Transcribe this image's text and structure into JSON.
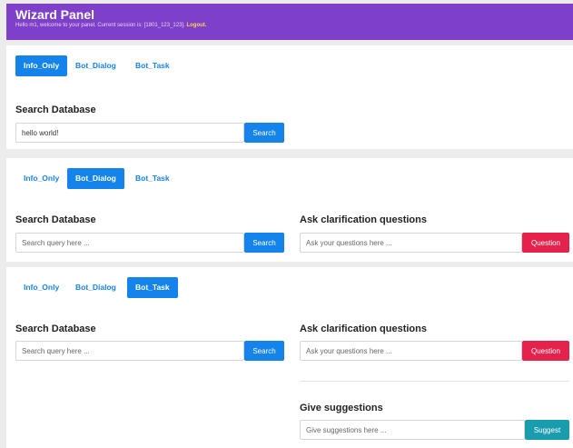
{
  "header": {
    "title": "Wizard Panel",
    "subtitle": "Hello m1, welcome to your panel. Current session is: [1801_123_123].",
    "logout": "Logout."
  },
  "tabs": [
    "Info_Only",
    "Bot_Dialog",
    "Bot_Task"
  ],
  "search": {
    "heading": "Search Database",
    "value": "hello world!",
    "placeholder": "Search query here ...",
    "button": "Search"
  },
  "ask": {
    "heading": "Ask clarification questions",
    "placeholder": "Ask your questions here ...",
    "button": "Question"
  },
  "suggest": {
    "heading": "Give suggestions",
    "placeholder": "Give suggestions here ...",
    "button": "Suggest"
  },
  "colors": {
    "header": "#7e3fc9",
    "primary": "#1583ec",
    "danger": "#e4224b",
    "info": "#1a9caf"
  }
}
